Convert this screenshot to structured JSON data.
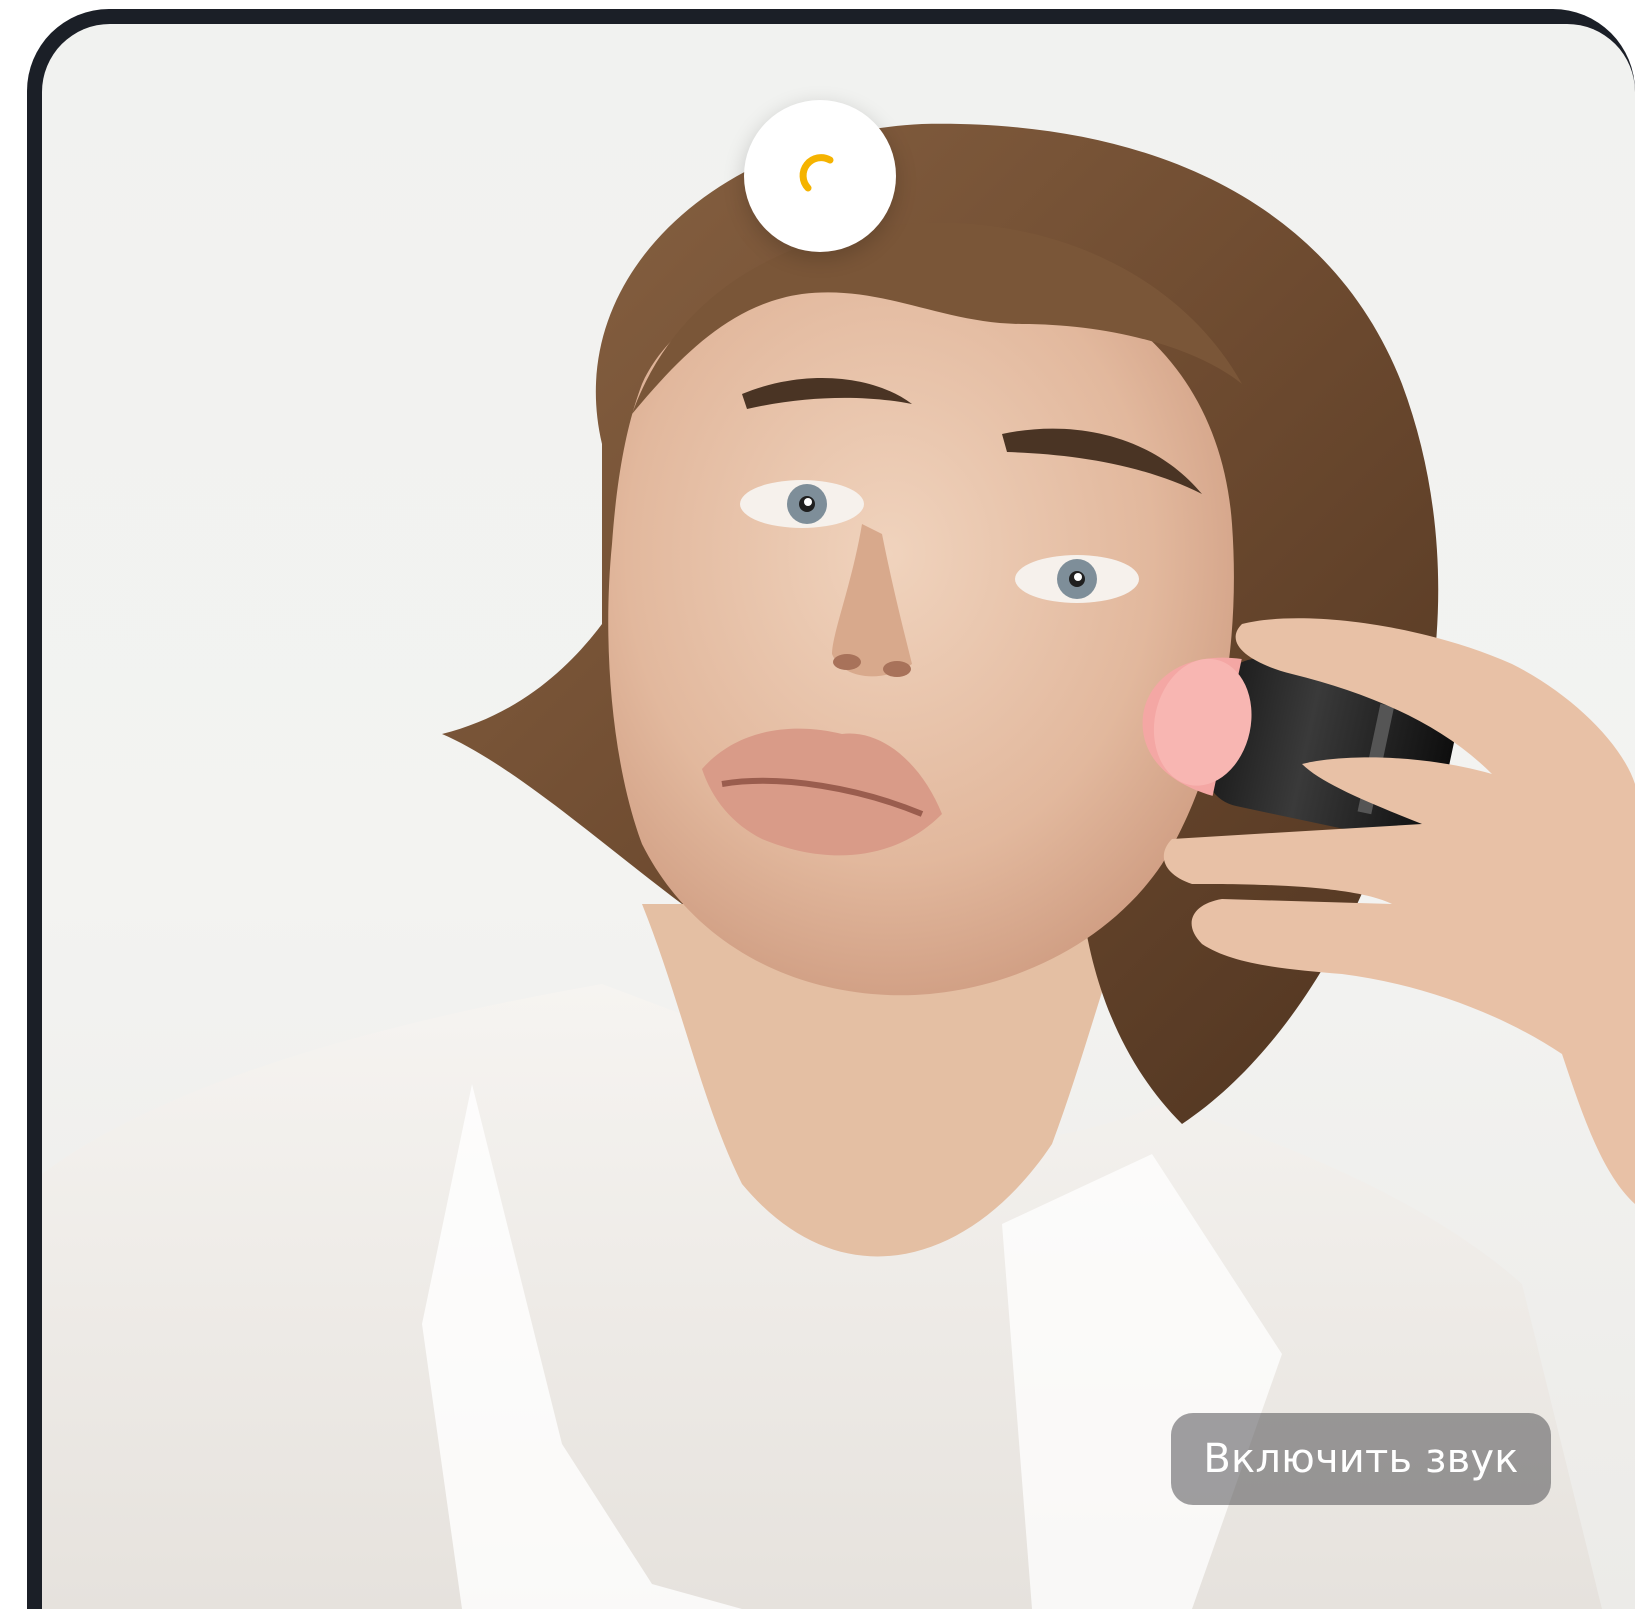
{
  "video": {
    "loader_icon": "spinner-icon",
    "loader_color": "#f5b300",
    "sound_button_label": "Включить звук"
  }
}
